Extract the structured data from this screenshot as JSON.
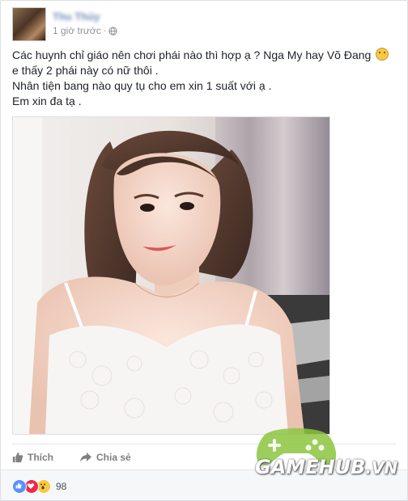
{
  "post": {
    "author_name": "Thu Thủy",
    "timestamp": "1 giờ trước",
    "body": [
      "Các huynh chỉ giáo nên chơi phái nào thì hợp ạ ? Nga My hay Võ Đang",
      "e thấy 2 phái này có nữ thôi .",
      "Nhân tiện bang nào quy tụ cho em xin 1 suất với ạ .",
      "Em xin đa tạ ."
    ],
    "emoji_icon": "smile-emoji-icon"
  },
  "actions": {
    "like_label": "Thích",
    "share_label": "Chia sẻ"
  },
  "reactions": {
    "count": "98",
    "types": [
      "like-icon",
      "love-icon",
      "wow-icon"
    ]
  },
  "watermark": {
    "brand": "GAMEHUB",
    "domain": ".VN",
    "color": "#8cc63f"
  },
  "colors": {
    "link": "#365899",
    "meta": "#90949c",
    "text": "#1d2129",
    "like": "#5890ff",
    "love": "#f0284a"
  }
}
